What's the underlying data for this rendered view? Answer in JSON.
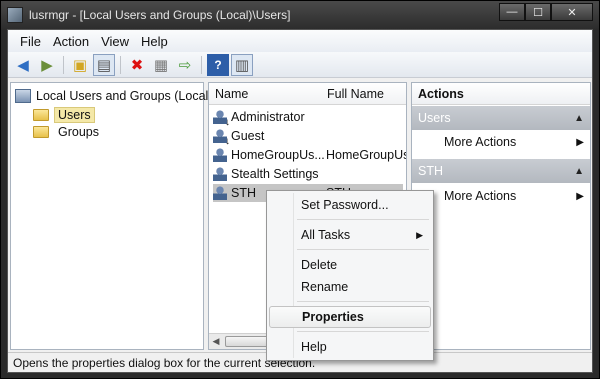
{
  "window": {
    "title": "lusrmgr - [Local Users and Groups (Local)\\Users]",
    "caption_minimize": "—",
    "caption_maximize": "☐",
    "caption_close": "✕"
  },
  "menu": [
    "File",
    "Action",
    "View",
    "Help"
  ],
  "toolbar_icons": [
    "back-arrow-icon",
    "forward-arrow-icon",
    "up-folder-icon",
    "show-hide-tree-icon",
    "delete-icon",
    "properties-icon",
    "export-list-icon",
    "help-icon",
    "show-hide-action-pane-icon"
  ],
  "tree": {
    "root": "Local Users and Groups (Local)",
    "children": [
      "Users",
      "Groups"
    ],
    "selected": "Users"
  },
  "list": {
    "columns": [
      "Name",
      "Full Name"
    ],
    "rows": [
      {
        "name": "Administrator",
        "full_name": ""
      },
      {
        "name": "Guest",
        "full_name": ""
      },
      {
        "name": "HomeGroupUs...",
        "full_name": "HomeGroupUs"
      },
      {
        "name": "Stealth Settings",
        "full_name": ""
      },
      {
        "name": "STH",
        "full_name": "STH"
      }
    ],
    "selected": "STH"
  },
  "actions": {
    "header": "Actions",
    "groups": [
      {
        "title": "Users",
        "item": "More Actions"
      },
      {
        "title": "STH",
        "item": "More Actions"
      }
    ]
  },
  "context_menu": {
    "items": [
      "Set Password...",
      "All Tasks",
      "Delete",
      "Rename",
      "Properties",
      "Help"
    ],
    "highlighted": "Properties"
  },
  "status": "Opens the properties dialog box for the current selection."
}
